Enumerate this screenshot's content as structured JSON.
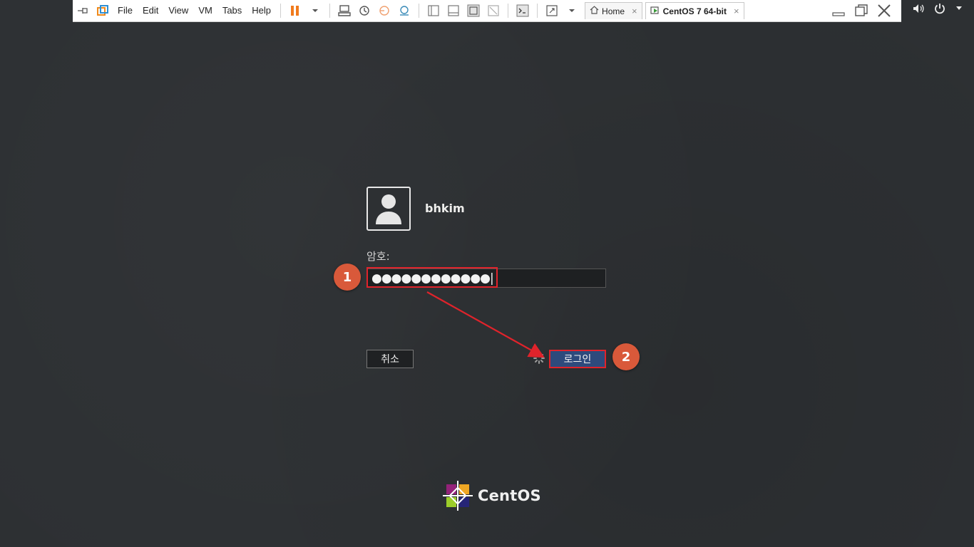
{
  "vm_toolbar": {
    "menu": [
      "File",
      "Edit",
      "View",
      "VM",
      "Tabs",
      "Help"
    ],
    "tabs": [
      {
        "label": "Home",
        "icon": "home-icon"
      },
      {
        "label": "CentOS 7 64-bit",
        "icon": "vm-icon"
      }
    ],
    "tab_close_glyph": "×"
  },
  "login": {
    "username": "bhkim",
    "password_label": "암호:",
    "password_masked": "●●●●●●●●●●●●|",
    "cancel_label": "취소",
    "login_label": "로그인"
  },
  "annotations": {
    "step1": "1",
    "step2": "2",
    "highlight_color": "#e0232b",
    "badge_color": "#d9593a"
  },
  "footer": {
    "logo_text": "CentOS"
  },
  "colors": {
    "background": "#2d3033",
    "login_button": "#2e4a7c"
  }
}
